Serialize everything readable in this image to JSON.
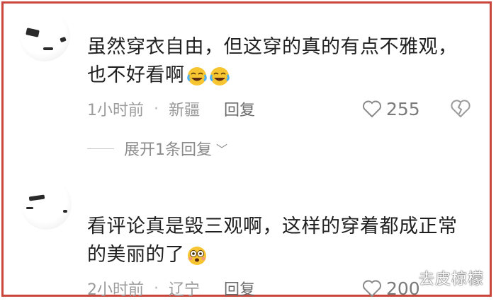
{
  "comments": [
    {
      "text": "虽然穿衣自由，但这穿的真的有点不雅观，也不好看啊",
      "emoji": [
        "rofl-emoji",
        "rofl-emoji"
      ],
      "time": "1小时前",
      "location": "新疆",
      "reply_label": "回复",
      "likes": "255",
      "expand_label": "展开1条回复"
    },
    {
      "text": "看评论真是毁三观啊，这样的穿着都成正常的美丽的了",
      "emoji": [
        "flushed-emoji"
      ],
      "time": "2小时前",
      "location": "辽宁",
      "reply_label": "回复",
      "likes": "200"
    }
  ],
  "separator": "·",
  "watermark": "去皮椋檬",
  "colors": {
    "border": "#c9463d",
    "meta": "#9b9b9b",
    "text": "#1f1f1f"
  }
}
